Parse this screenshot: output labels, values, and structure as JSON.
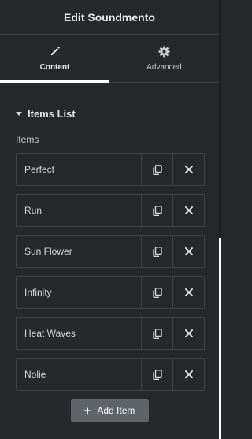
{
  "header": {
    "title": "Edit Soundmento"
  },
  "tabs": [
    {
      "label": "Content",
      "icon": "pencil-icon",
      "active": true
    },
    {
      "label": "Advanced",
      "icon": "gear-icon",
      "active": false
    }
  ],
  "section": {
    "title": "Items List"
  },
  "items_label": "Items",
  "items": [
    {
      "title": "Perfect"
    },
    {
      "title": "Run"
    },
    {
      "title": "Sun Flower"
    },
    {
      "title": "Infinity"
    },
    {
      "title": "Heat Waves"
    },
    {
      "title": "Nolie"
    }
  ],
  "add_button": {
    "label": "Add Item"
  },
  "colors": {
    "background": "#26292c",
    "accent_underline": "#ffffff",
    "button": "#5e6469"
  }
}
